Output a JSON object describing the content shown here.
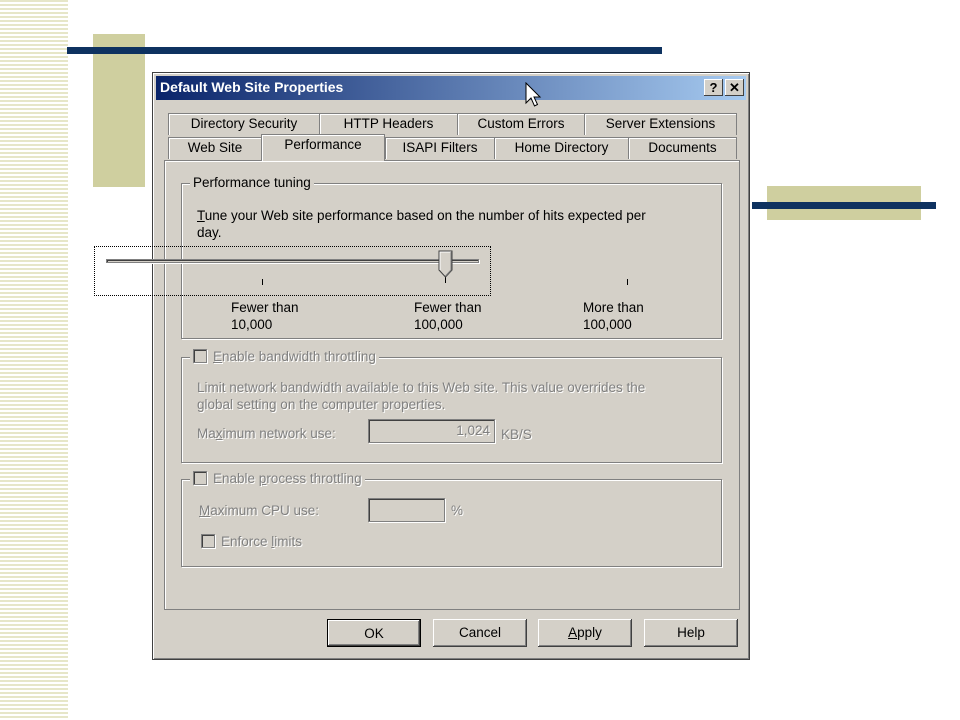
{
  "dialog": {
    "title": "Default Web Site Properties",
    "help_btn": "?",
    "close_btn": "✕"
  },
  "tabs_back": [
    "Directory Security",
    "HTTP Headers",
    "Custom Errors",
    "Server Extensions"
  ],
  "tabs_front": [
    "Web Site",
    "Performance",
    "ISAPI Filters",
    "Home Directory",
    "Documents"
  ],
  "active_tab": "Performance",
  "performance": {
    "group_label": "Performance tuning",
    "desc_line1_u": "T",
    "desc_line1_rest": "une your Web site performance based on the number of hits expected per",
    "desc_line2": "day.",
    "slider_value_label": "Fewer than 100,000",
    "labels": [
      {
        "l1": "Fewer than",
        "l2": "10,000"
      },
      {
        "l1": "Fewer than",
        "l2": "100,000"
      },
      {
        "l1": "More than",
        "l2": "100,000"
      }
    ]
  },
  "bandwidth": {
    "checkbox_u": "E",
    "checkbox_rest": "nable bandwidth throttling",
    "desc1": "Limit network bandwidth available to this Web site.  This value overrides the",
    "desc2": "global setting on the computer properties.",
    "max_label_pre": "Ma",
    "max_label_u": "x",
    "max_label_post": "imum network use:",
    "value": "1,024",
    "unit": "KB/S"
  },
  "process": {
    "checkbox_pre": "Enable ",
    "checkbox_u": "p",
    "checkbox_post": "rocess throttling",
    "cpu_pre": "",
    "cpu_u": "M",
    "cpu_post": "aximum CPU use:",
    "cpu_value": "",
    "cpu_unit": "%",
    "enforce_pre": "Enforce ",
    "enforce_u": "l",
    "enforce_post": "imits"
  },
  "buttons": {
    "ok": "OK",
    "cancel": "Cancel",
    "apply_u": "A",
    "apply_rest": "pply",
    "help": "Help"
  }
}
